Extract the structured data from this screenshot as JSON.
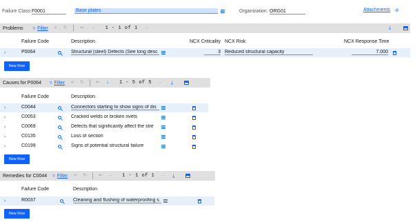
{
  "header": {
    "failure_class_label": "Failure Class:",
    "failure_class_value": "F0001",
    "failure_class_desc": "Base plates",
    "organization_label": "Organization:",
    "organization_value": "ORG01",
    "attachments_label": "Attachments"
  },
  "problems": {
    "title": "Problems",
    "filter_label": "Filter",
    "pagination": "1 - 1 of 1",
    "columns": [
      "Failure Code",
      "Description",
      "NCX Criticality",
      "NCX Risk",
      "NCX Response Time"
    ],
    "rows": [
      {
        "code": "P0064",
        "description": "Structural (steel) Defects (See long desc",
        "criticality": "3",
        "risk": "Reduced structural capacity",
        "response_time": "7.000"
      }
    ],
    "new_row_label": "New Row"
  },
  "causes": {
    "title": "Causes for P0064",
    "filter_label": "Filter",
    "pagination": "1 - 5 of 5",
    "columns": [
      "Failure Code",
      "Description"
    ],
    "rows": [
      {
        "code": "C0044",
        "description": "Connectors starting to show signs of dis"
      },
      {
        "code": "C0053",
        "description": "Cracked welds or broken rivets"
      },
      {
        "code": "C0069",
        "description": "Defects that significantly affect the stre"
      },
      {
        "code": "C0135",
        "description": "Loss of section"
      },
      {
        "code": "C0199",
        "description": "Signs of potential structural failure"
      }
    ],
    "new_row_label": "New Row"
  },
  "remedies": {
    "title": "Remedies for C0044",
    "filter_label": "Filter",
    "pagination": "1 - 1 of 1",
    "columns": [
      "Failure Code",
      "Description"
    ],
    "rows": [
      {
        "code": "R0037",
        "description": "Cleaning and flushing of waterproofing s"
      }
    ],
    "new_row_label": "New Row"
  },
  "colors": {
    "accent": "#0f62fe",
    "toolbar_bg": "#e0e0e0",
    "selected_row": "#e5f0fb"
  }
}
